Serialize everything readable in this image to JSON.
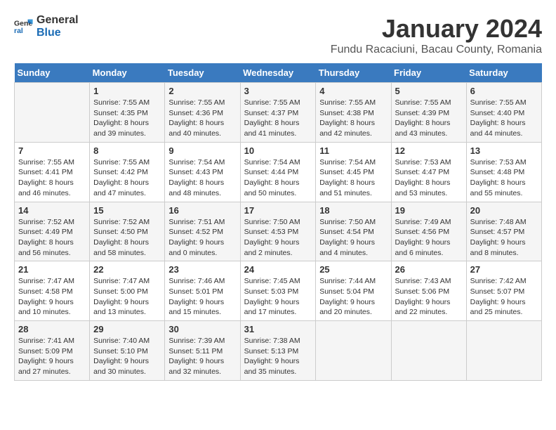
{
  "logo": {
    "line1": "General",
    "line2": "Blue"
  },
  "title": "January 2024",
  "location": "Fundu Racaciuni, Bacau County, Romania",
  "days_of_week": [
    "Sunday",
    "Monday",
    "Tuesday",
    "Wednesday",
    "Thursday",
    "Friday",
    "Saturday"
  ],
  "weeks": [
    [
      {
        "day": "",
        "info": ""
      },
      {
        "day": "1",
        "info": "Sunrise: 7:55 AM\nSunset: 4:35 PM\nDaylight: 8 hours\nand 39 minutes."
      },
      {
        "day": "2",
        "info": "Sunrise: 7:55 AM\nSunset: 4:36 PM\nDaylight: 8 hours\nand 40 minutes."
      },
      {
        "day": "3",
        "info": "Sunrise: 7:55 AM\nSunset: 4:37 PM\nDaylight: 8 hours\nand 41 minutes."
      },
      {
        "day": "4",
        "info": "Sunrise: 7:55 AM\nSunset: 4:38 PM\nDaylight: 8 hours\nand 42 minutes."
      },
      {
        "day": "5",
        "info": "Sunrise: 7:55 AM\nSunset: 4:39 PM\nDaylight: 8 hours\nand 43 minutes."
      },
      {
        "day": "6",
        "info": "Sunrise: 7:55 AM\nSunset: 4:40 PM\nDaylight: 8 hours\nand 44 minutes."
      }
    ],
    [
      {
        "day": "7",
        "info": "Sunrise: 7:55 AM\nSunset: 4:41 PM\nDaylight: 8 hours\nand 46 minutes."
      },
      {
        "day": "8",
        "info": "Sunrise: 7:55 AM\nSunset: 4:42 PM\nDaylight: 8 hours\nand 47 minutes."
      },
      {
        "day": "9",
        "info": "Sunrise: 7:54 AM\nSunset: 4:43 PM\nDaylight: 8 hours\nand 48 minutes."
      },
      {
        "day": "10",
        "info": "Sunrise: 7:54 AM\nSunset: 4:44 PM\nDaylight: 8 hours\nand 50 minutes."
      },
      {
        "day": "11",
        "info": "Sunrise: 7:54 AM\nSunset: 4:45 PM\nDaylight: 8 hours\nand 51 minutes."
      },
      {
        "day": "12",
        "info": "Sunrise: 7:53 AM\nSunset: 4:47 PM\nDaylight: 8 hours\nand 53 minutes."
      },
      {
        "day": "13",
        "info": "Sunrise: 7:53 AM\nSunset: 4:48 PM\nDaylight: 8 hours\nand 55 minutes."
      }
    ],
    [
      {
        "day": "14",
        "info": "Sunrise: 7:52 AM\nSunset: 4:49 PM\nDaylight: 8 hours\nand 56 minutes."
      },
      {
        "day": "15",
        "info": "Sunrise: 7:52 AM\nSunset: 4:50 PM\nDaylight: 8 hours\nand 58 minutes."
      },
      {
        "day": "16",
        "info": "Sunrise: 7:51 AM\nSunset: 4:52 PM\nDaylight: 9 hours\nand 0 minutes."
      },
      {
        "day": "17",
        "info": "Sunrise: 7:50 AM\nSunset: 4:53 PM\nDaylight: 9 hours\nand 2 minutes."
      },
      {
        "day": "18",
        "info": "Sunrise: 7:50 AM\nSunset: 4:54 PM\nDaylight: 9 hours\nand 4 minutes."
      },
      {
        "day": "19",
        "info": "Sunrise: 7:49 AM\nSunset: 4:56 PM\nDaylight: 9 hours\nand 6 minutes."
      },
      {
        "day": "20",
        "info": "Sunrise: 7:48 AM\nSunset: 4:57 PM\nDaylight: 9 hours\nand 8 minutes."
      }
    ],
    [
      {
        "day": "21",
        "info": "Sunrise: 7:47 AM\nSunset: 4:58 PM\nDaylight: 9 hours\nand 10 minutes."
      },
      {
        "day": "22",
        "info": "Sunrise: 7:47 AM\nSunset: 5:00 PM\nDaylight: 9 hours\nand 13 minutes."
      },
      {
        "day": "23",
        "info": "Sunrise: 7:46 AM\nSunset: 5:01 PM\nDaylight: 9 hours\nand 15 minutes."
      },
      {
        "day": "24",
        "info": "Sunrise: 7:45 AM\nSunset: 5:03 PM\nDaylight: 9 hours\nand 17 minutes."
      },
      {
        "day": "25",
        "info": "Sunrise: 7:44 AM\nSunset: 5:04 PM\nDaylight: 9 hours\nand 20 minutes."
      },
      {
        "day": "26",
        "info": "Sunrise: 7:43 AM\nSunset: 5:06 PM\nDaylight: 9 hours\nand 22 minutes."
      },
      {
        "day": "27",
        "info": "Sunrise: 7:42 AM\nSunset: 5:07 PM\nDaylight: 9 hours\nand 25 minutes."
      }
    ],
    [
      {
        "day": "28",
        "info": "Sunrise: 7:41 AM\nSunset: 5:09 PM\nDaylight: 9 hours\nand 27 minutes."
      },
      {
        "day": "29",
        "info": "Sunrise: 7:40 AM\nSunset: 5:10 PM\nDaylight: 9 hours\nand 30 minutes."
      },
      {
        "day": "30",
        "info": "Sunrise: 7:39 AM\nSunset: 5:11 PM\nDaylight: 9 hours\nand 32 minutes."
      },
      {
        "day": "31",
        "info": "Sunrise: 7:38 AM\nSunset: 5:13 PM\nDaylight: 9 hours\nand 35 minutes."
      },
      {
        "day": "",
        "info": ""
      },
      {
        "day": "",
        "info": ""
      },
      {
        "day": "",
        "info": ""
      }
    ]
  ]
}
